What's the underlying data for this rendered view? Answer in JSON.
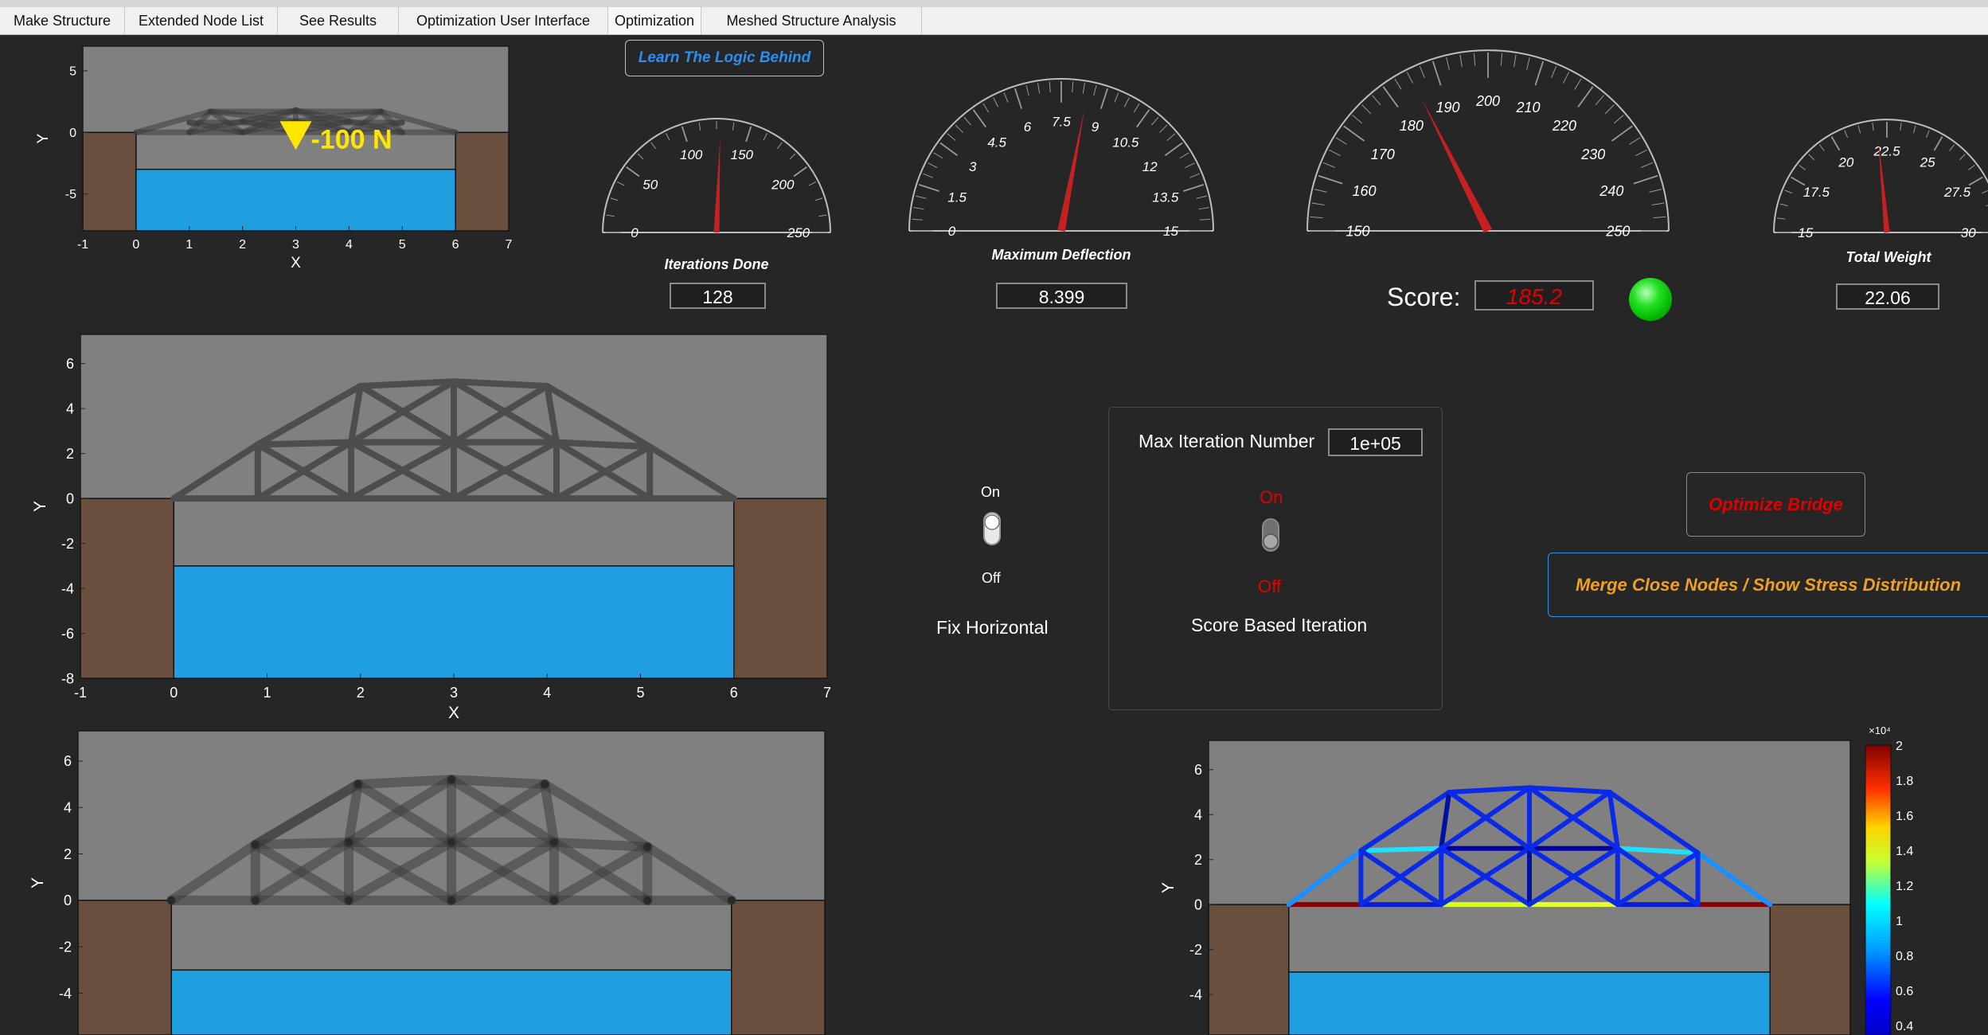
{
  "tabs": [
    {
      "label": "Make Structure"
    },
    {
      "label": "Extended Node List"
    },
    {
      "label": "See Results"
    },
    {
      "label": "Optimization User Interface"
    },
    {
      "label": "Optimization"
    },
    {
      "label": "Meshed Structure Analysis"
    }
  ],
  "active_tab": "Optimization",
  "buttons": {
    "learn": "Learn The Logic Behind",
    "optimize": "Optimize Bridge",
    "merge": "Merge Close Nodes / Show Stress Distribution"
  },
  "gauges": {
    "iterations": {
      "label": "Iterations Done",
      "ticks": [
        "0",
        "50",
        "100",
        "150",
        "200",
        "250"
      ],
      "min": 0,
      "max": 250,
      "needle": 128,
      "value": "128"
    },
    "deflection": {
      "label": "Maximum Deflection",
      "ticks": [
        "0",
        "1.5",
        "3",
        "4.5",
        "6",
        "7.5",
        "9",
        "10.5",
        "12",
        "13.5",
        "15"
      ],
      "min": 0,
      "max": 15,
      "needle": 8.399,
      "value": "8.399"
    },
    "score": {
      "label": "Score:",
      "ticks": [
        "150",
        "160",
        "170",
        "180",
        "190",
        "200",
        "210",
        "220",
        "230",
        "240",
        "250"
      ],
      "min": 150,
      "max": 250,
      "needle": 185.2,
      "value": "185.2"
    },
    "weight": {
      "label": "Total Weight",
      "ticks": [
        "15",
        "17.5",
        "20",
        "22.5",
        "25",
        "27.5",
        "30"
      ],
      "min": 15,
      "max": 30,
      "needle": 22.06,
      "value": "22.06"
    }
  },
  "status_lamp": {
    "color": "#00d400"
  },
  "max_iter": {
    "label": "Max Iteration Number",
    "value": "1e+05"
  },
  "switch_fix": {
    "on": "On",
    "off": "Off",
    "label": "Fix Horizontal"
  },
  "switch_score": {
    "on": "On",
    "off": "Off",
    "label": "Score Based Iteration"
  },
  "load_label": "-100 N",
  "colors": {
    "water": "#1f9fe0",
    "ground": "#6b4f3e",
    "sky": "#808080",
    "truss": "#4d4d4d",
    "accent_red": "#e00000",
    "accent_orange": "#f0a020",
    "accent_blue": "#2a8ff0"
  },
  "plots": {
    "top": {
      "xlabel": "X",
      "ylabel": "Y",
      "xticks": [
        "-1",
        "0",
        "1",
        "2",
        "3",
        "4",
        "5",
        "6",
        "7"
      ],
      "yticks": [
        "5",
        "0",
        "-5"
      ]
    },
    "mid": {
      "xlabel": "X",
      "ylabel": "Y",
      "xticks": [
        "-1",
        "0",
        "1",
        "2",
        "3",
        "4",
        "5",
        "6",
        "7"
      ],
      "yticks": [
        "6",
        "4",
        "2",
        "0",
        "-2",
        "-4",
        "-6",
        "-8"
      ]
    },
    "bot": {
      "ylabel": "Y",
      "yticks": [
        "6",
        "4",
        "2",
        "0",
        "-2",
        "-4"
      ]
    },
    "stress": {
      "ylabel": "Y",
      "yticks": [
        "6",
        "4",
        "2",
        "0",
        "-2",
        "-4"
      ],
      "colorbar_exp": "×10⁴",
      "colorbar_ticks": [
        "2",
        "1.8",
        "1.6",
        "1.4",
        "1.2",
        "1",
        "0.8",
        "0.6",
        "0.4"
      ]
    }
  }
}
